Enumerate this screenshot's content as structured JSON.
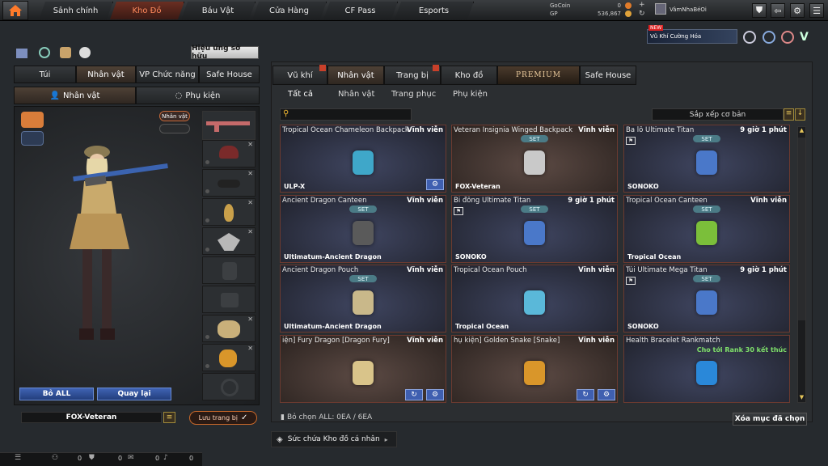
{
  "topnav": {
    "tabs": [
      "Sảnh chính",
      "Kho Đồ",
      "Báu Vật",
      "Cửa Hàng",
      "CF Pass",
      "Esports"
    ],
    "active": "Kho Đồ"
  },
  "currency": {
    "gocoin_label": "GoCoin",
    "gocoin_value": "0",
    "gp_label": "GP",
    "gp_value": "536,867"
  },
  "user": {
    "name": "VâmNhaBéOi"
  },
  "promo": {
    "badge": "NEW",
    "text": "Vũ Khí Cường Hóa"
  },
  "left": {
    "effect_button": "Hiệu ứng sở hữu",
    "tabs": [
      "Túi",
      "Nhân vật",
      "VP Chức năng",
      "Safe House"
    ],
    "active_tab": "Nhân vật",
    "subtabs": [
      "Nhân vật",
      "Phụ kiện"
    ],
    "char_toggle": "Nhân vật",
    "btn_remove_all": "Bỏ ALL",
    "btn_back": "Quay lại",
    "preset_name": "FOX-Veteran",
    "save_btn": "Lưu trang bị"
  },
  "right": {
    "tabs": [
      "Vũ khí",
      "Nhân vật",
      "Trang bị",
      "Kho đồ",
      "PREMIUM",
      "Safe House"
    ],
    "active_tab": "Nhân vật",
    "categories": [
      "Tất cả",
      "Nhân vật",
      "Trang phục",
      "Phụ kiện"
    ],
    "sort_label": "Sắp xếp cơ bản",
    "deselect_all": "Bỏ chọn ALL: 0EA / 6EA",
    "clear_btn": "Xóa mục đã chọn",
    "capacity": "Sức chứa Kho đồ cá nhân"
  },
  "items": [
    {
      "name": "Tropical Ocean Chameleon Backpack",
      "duration": "Vĩnh viễn",
      "group": "ULP-X",
      "set": "",
      "icon": "chameleon-backpack-icon",
      "warm": false
    },
    {
      "name": "Veteran Insignia Winged Backpack",
      "duration": "Vĩnh viễn",
      "group": "FOX-Veteran",
      "set": "SET",
      "icon": "winged-backpack-icon",
      "warm": true
    },
    {
      "name": "Ba lô Ultimate Titan",
      "duration": "9 giờ 1 phút",
      "group": "SONOKO",
      "set": "SET",
      "icon": "titan-backpack-icon",
      "warm": false
    },
    {
      "name": "Ancient Dragon Canteen",
      "duration": "Vĩnh viễn",
      "group": "Ultimatum-Ancient Dragon",
      "set": "SET",
      "icon": "dragon-canteen-icon",
      "warm": false
    },
    {
      "name": "Bi đông Ultimate Titan",
      "duration": "9 giờ 1 phút",
      "group": "SONOKO",
      "set": "SET",
      "icon": "titan-canteen-icon",
      "warm": false
    },
    {
      "name": "Tropical Ocean Canteen",
      "duration": "Vĩnh viễn",
      "group": "Tropical Ocean",
      "set": "SET",
      "icon": "coconut-canteen-icon",
      "warm": false
    },
    {
      "name": "Ancient Dragon Pouch",
      "duration": "Vĩnh viễn",
      "group": "Ultimatum-Ancient Dragon",
      "set": "SET",
      "icon": "dragon-pouch-icon",
      "warm": false
    },
    {
      "name": "Tropical Ocean Pouch",
      "duration": "Vĩnh viễn",
      "group": "Tropical Ocean",
      "set": "",
      "icon": "ocean-pouch-icon",
      "warm": false
    },
    {
      "name": "Túi Ultimate Mega Titan",
      "duration": "9 giờ 1 phút",
      "group": "SONOKO",
      "set": "SET",
      "icon": "titan-pouch-icon",
      "warm": false
    },
    {
      "name": "iện] Fury Dragon [Dragon Fury]",
      "duration": "Vĩnh viễn",
      "group": "",
      "set": "",
      "icon": "fury-dragon-icon",
      "warm": true
    },
    {
      "name": "hụ kiện] Golden Snake [Snake]",
      "duration": "Vĩnh viễn",
      "group": "",
      "set": "",
      "icon": "golden-snake-icon",
      "warm": true
    },
    {
      "name": "Health Bracelet Rankmatch",
      "duration": "",
      "group": "",
      "set": "",
      "icon": "bracelet-icon",
      "warm": false,
      "note": "Cho tới Rank 30 kết thúc"
    }
  ],
  "bottombar": {
    "values": [
      "0",
      "0",
      "0",
      "0"
    ]
  }
}
